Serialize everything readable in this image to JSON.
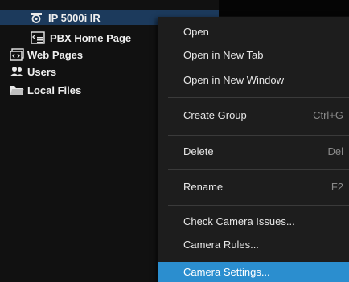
{
  "tree": {
    "items": [
      {
        "label": "IP 5000i IR",
        "icon": "camera-icon"
      },
      {
        "label": "PBX Home Page",
        "icon": "webpage-icon"
      },
      {
        "label": "Web Pages",
        "icon": "web-pages-icon"
      },
      {
        "label": "Users",
        "icon": "users-icon"
      },
      {
        "label": "Local Files",
        "icon": "folder-icon"
      }
    ]
  },
  "context_menu": {
    "items": [
      {
        "label": "Open",
        "shortcut": ""
      },
      {
        "label": "Open in New Tab",
        "shortcut": ""
      },
      {
        "label": "Open in New Window",
        "shortcut": ""
      },
      {
        "label": "Create Group",
        "shortcut": "Ctrl+G"
      },
      {
        "label": "Delete",
        "shortcut": "Del"
      },
      {
        "label": "Rename",
        "shortcut": "F2"
      },
      {
        "label": "Check Camera Issues...",
        "shortcut": ""
      },
      {
        "label": "Camera Rules...",
        "shortcut": ""
      },
      {
        "label": "Camera Settings...",
        "shortcut": ""
      }
    ],
    "highlighted": "Camera Settings..."
  },
  "colors": {
    "highlight": "#2b8ecf",
    "selected_row": "#1c3a5c",
    "menu_bg": "#1d1d1d"
  }
}
